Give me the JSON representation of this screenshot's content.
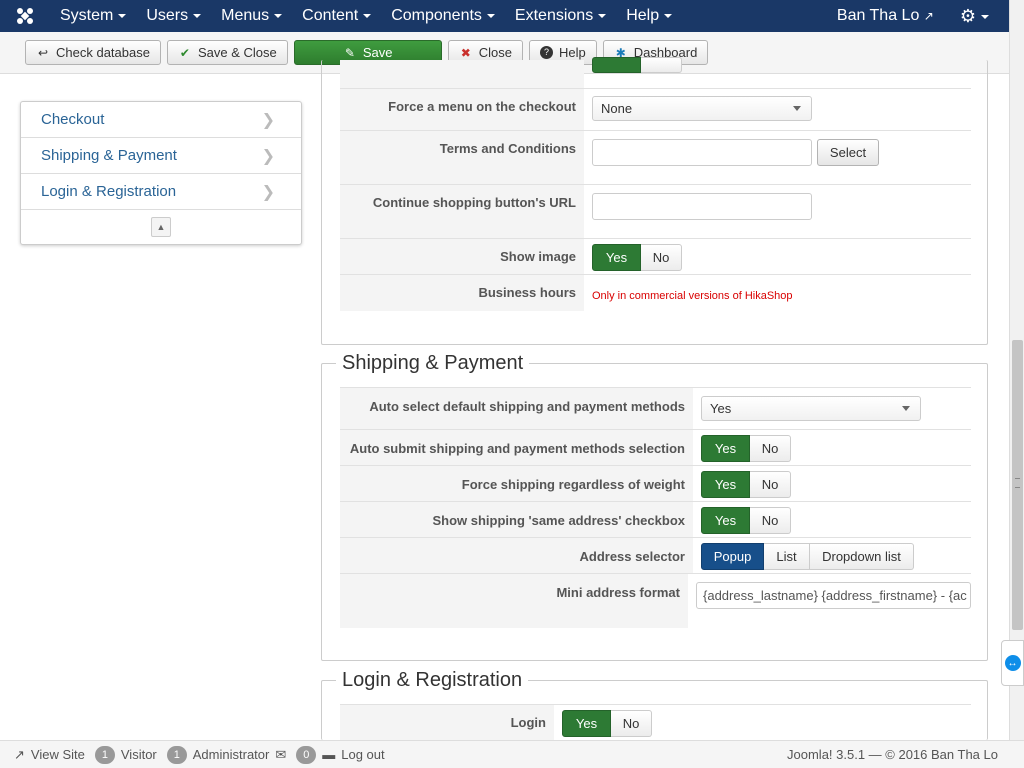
{
  "navbar": {
    "logo_icon": "joomla-logo-icon",
    "menus": [
      "System",
      "Users",
      "Menus",
      "Content",
      "Components",
      "Extensions",
      "Help"
    ],
    "user": "Ban Tha Lo",
    "user_icon": "external-link-icon",
    "settings_icon": "gear-icon"
  },
  "toolbar": {
    "check_db": "Check database",
    "save_close": "Save & Close",
    "save": "Save",
    "close": "Close",
    "help": "Help",
    "dashboard": "Dashboard"
  },
  "sidebar": {
    "items": [
      {
        "label": "Checkout"
      },
      {
        "label": "Shipping & Payment"
      },
      {
        "label": "Login & Registration"
      }
    ]
  },
  "checkout": {
    "force_menu": {
      "label": "Force a menu on the checkout",
      "value": "None"
    },
    "terms": {
      "label": "Terms and Conditions",
      "value": "",
      "button": "Select"
    },
    "continue_url": {
      "label": "Continue shopping button's URL",
      "value": ""
    },
    "show_image": {
      "label": "Show image",
      "yes": "Yes",
      "no": "No",
      "selected": "Yes"
    },
    "business_hours": {
      "label": "Business hours",
      "note": "Only in commercial versions of HikaShop"
    }
  },
  "shipping": {
    "legend": "Shipping & Payment",
    "auto_select": {
      "label": "Auto select default shipping and payment methods",
      "value": "Yes"
    },
    "auto_submit": {
      "label": "Auto submit shipping and payment methods selection",
      "yes": "Yes",
      "no": "No",
      "selected": "Yes"
    },
    "force_shipping": {
      "label": "Force shipping regardless of weight",
      "yes": "Yes",
      "no": "No",
      "selected": "Yes"
    },
    "same_address": {
      "label": "Show shipping 'same address' checkbox",
      "yes": "Yes",
      "no": "No",
      "selected": "Yes"
    },
    "address_selector": {
      "label": "Address selector",
      "options": [
        "Popup",
        "List",
        "Dropdown list"
      ],
      "selected": "Popup"
    },
    "mini_address": {
      "label": "Mini address format",
      "value": "{address_lastname} {address_firstname} - {ac"
    }
  },
  "login": {
    "legend": "Login & Registration",
    "login": {
      "label": "Login",
      "yes": "Yes",
      "no": "No",
      "selected": "Yes"
    }
  },
  "statusbar": {
    "view_site": "View Site",
    "visitor_count": "1",
    "visitor": "Visitor",
    "admin_count": "1",
    "admin": "Administrator",
    "messages_count": "0",
    "logout": "Log out",
    "version": "Joomla! 3.5.1 — © 2016 Ban Tha Lo"
  },
  "colors": {
    "navbar": "#1a3867",
    "save_green": "#2d7a34",
    "toggle_on": "#2d7a34",
    "popup_blue": "#174f8a",
    "warn_red": "#d90000",
    "link": "#2a6496"
  }
}
